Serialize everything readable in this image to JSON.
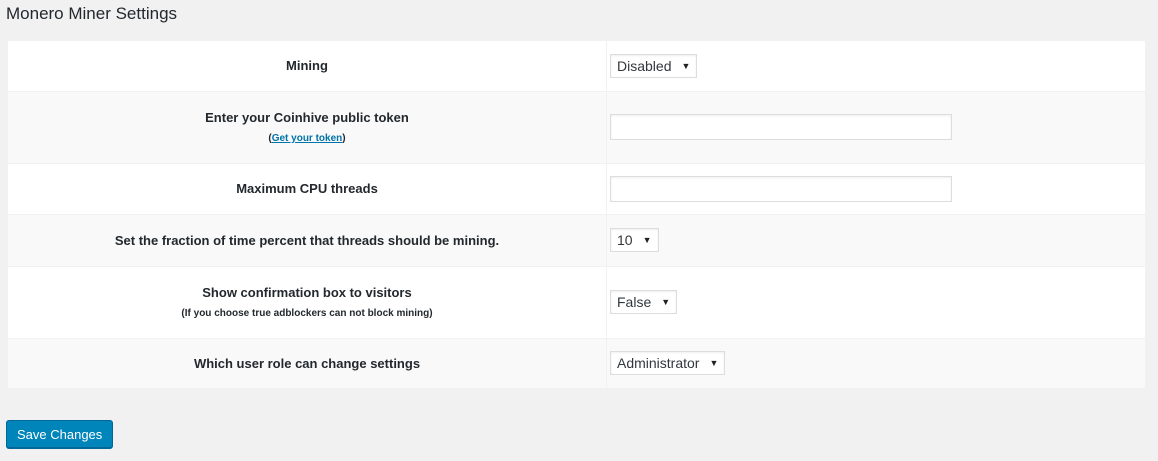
{
  "page": {
    "title": "Monero Miner Settings"
  },
  "rows": [
    {
      "label": "Mining",
      "control": "select",
      "value": "Disabled"
    },
    {
      "label": "Enter your Coinhive public token",
      "sub_prefix": "(",
      "sub_link": "Get your token",
      "sub_suffix": ")",
      "control": "text",
      "value": ""
    },
    {
      "label": "Maximum CPU threads",
      "control": "text",
      "value": ""
    },
    {
      "label": "Set the fraction of time percent that threads should be mining.",
      "control": "select",
      "value": "10"
    },
    {
      "label": "Show confirmation box to visitors",
      "sub": "(If you choose true adblockers can not block mining)",
      "control": "select",
      "value": "False"
    },
    {
      "label": "Which user role can change settings",
      "control": "select",
      "value": "Administrator"
    }
  ],
  "footer": {
    "save_label": "Save Changes"
  },
  "colors": {
    "accent": "#0085ba",
    "link": "#0073aa",
    "background": "#f1f1f1"
  }
}
